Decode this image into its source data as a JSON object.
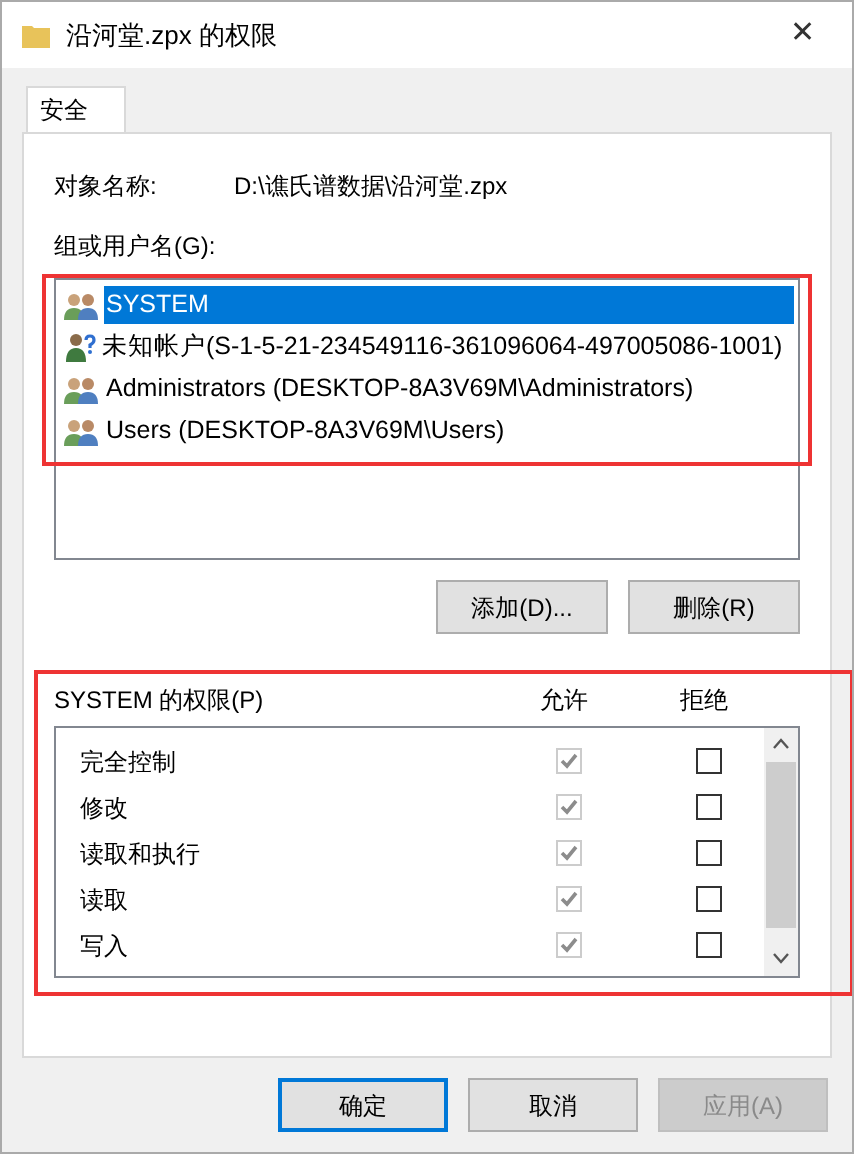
{
  "window": {
    "title": "沿河堂.zpx 的权限",
    "close": "✕"
  },
  "tabs": [
    {
      "label": "安全",
      "selected": true
    }
  ],
  "object_name": {
    "label": "对象名称:",
    "value": "D:\\谯氏谱数据\\沿河堂.zpx"
  },
  "groups": {
    "label": "组或用户名(G):",
    "items": [
      {
        "name": "SYSTEM",
        "kind": "group",
        "selected": true
      },
      {
        "name": "未知帐户(S-1-5-21-234549116-361096064-497005086-1001)",
        "kind": "unknown",
        "selected": false
      },
      {
        "name": "Administrators (DESKTOP-8A3V69M\\Administrators)",
        "kind": "group",
        "selected": false
      },
      {
        "name": "Users (DESKTOP-8A3V69M\\Users)",
        "kind": "group",
        "selected": false
      }
    ],
    "buttons": [
      "添加(D)...",
      "删除(R)"
    ]
  },
  "permissions": {
    "label": "SYSTEM 的权限(P)",
    "allow_header": "允许",
    "deny_header": "拒绝",
    "rows": [
      {
        "name": "完全控制",
        "allow": true,
        "deny": false
      },
      {
        "name": "修改",
        "allow": true,
        "deny": false
      },
      {
        "name": "读取和执行",
        "allow": true,
        "deny": false
      },
      {
        "name": "读取",
        "allow": true,
        "deny": false
      },
      {
        "name": "写入",
        "allow": true,
        "deny": false
      }
    ]
  },
  "buttons": [
    {
      "label": "确定",
      "default": true,
      "disabled": false
    },
    {
      "label": "取消",
      "default": false,
      "disabled": false
    },
    {
      "label": "应用(A)",
      "default": false,
      "disabled": true
    }
  ]
}
